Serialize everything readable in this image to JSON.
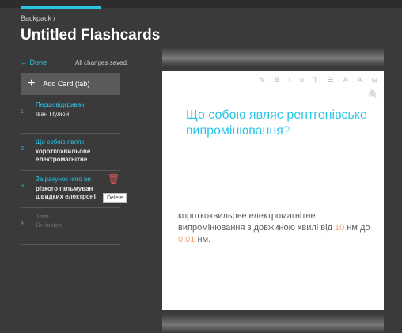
{
  "breadcrumb": "Backpack /",
  "title": "Untitled Flashcards",
  "done_label": "← Done",
  "status": "All changes saved.",
  "add_card": {
    "icon": "plus-icon",
    "label": "Add Card (tab)"
  },
  "cards": [
    {
      "num": "1",
      "term": "Першовідкривач",
      "definition": "Іван Пулюй"
    },
    {
      "num": "2",
      "term": "Що собою являє",
      "definition": "короткохвильове\nелектромагнітне"
    },
    {
      "num": "3",
      "term": "За рахунок чого ви",
      "definition": "різкого гальмуван\nшвидких електроні"
    },
    {
      "num": "4",
      "term": "Term",
      "definition": "Definition"
    }
  ],
  "delete_tooltip": "Delete",
  "toolbar": [
    "fx",
    "B",
    "i",
    "u",
    "T",
    "☰",
    "A",
    "A",
    "⊟"
  ],
  "question": {
    "text": "Що собою являє рентгенівське випромінювання",
    "mark": "?"
  },
  "answer": {
    "prefix": "короткохвильове електромагнітне випромінювання з довжиною хвилі від ",
    "v1": "10",
    "mid1": " нм до ",
    "v2": "0.01",
    "suffix": " нм."
  },
  "colors": {
    "accent": "#29c5e6",
    "highlight": "#f2a47a",
    "delete": "#e05656"
  }
}
